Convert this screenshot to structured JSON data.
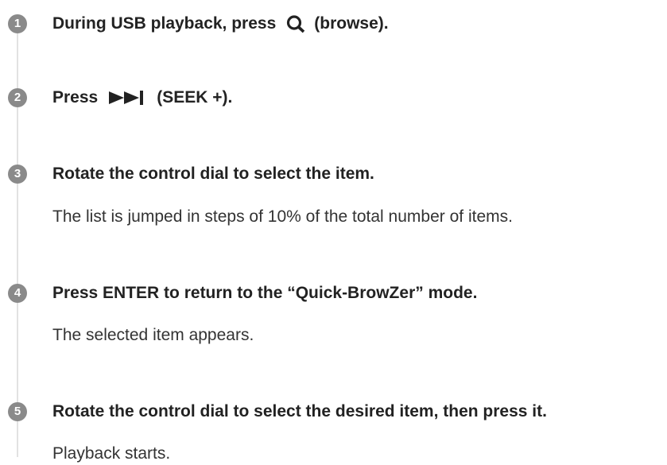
{
  "steps": [
    {
      "number": "1",
      "title_before": "During USB playback, press",
      "icon": "magnifier-icon",
      "title_after": "(browse)."
    },
    {
      "number": "2",
      "title_before": "Press",
      "icon": "skip-forward-icon",
      "title_after": "(SEEK +)."
    },
    {
      "number": "3",
      "title": "Rotate the control dial to select the item.",
      "description": "The list is jumped in steps of 10% of the total number of items."
    },
    {
      "number": "4",
      "title": "Press ENTER to return to the “Quick-BrowZer” mode.",
      "description": "The selected item appears."
    },
    {
      "number": "5",
      "title": "Rotate the control dial to select the desired item, then press it.",
      "description": "Playback starts."
    }
  ],
  "colors": {
    "badge": "#8a8a8a",
    "timeline": "#e2e2e2",
    "text": "#222222"
  }
}
